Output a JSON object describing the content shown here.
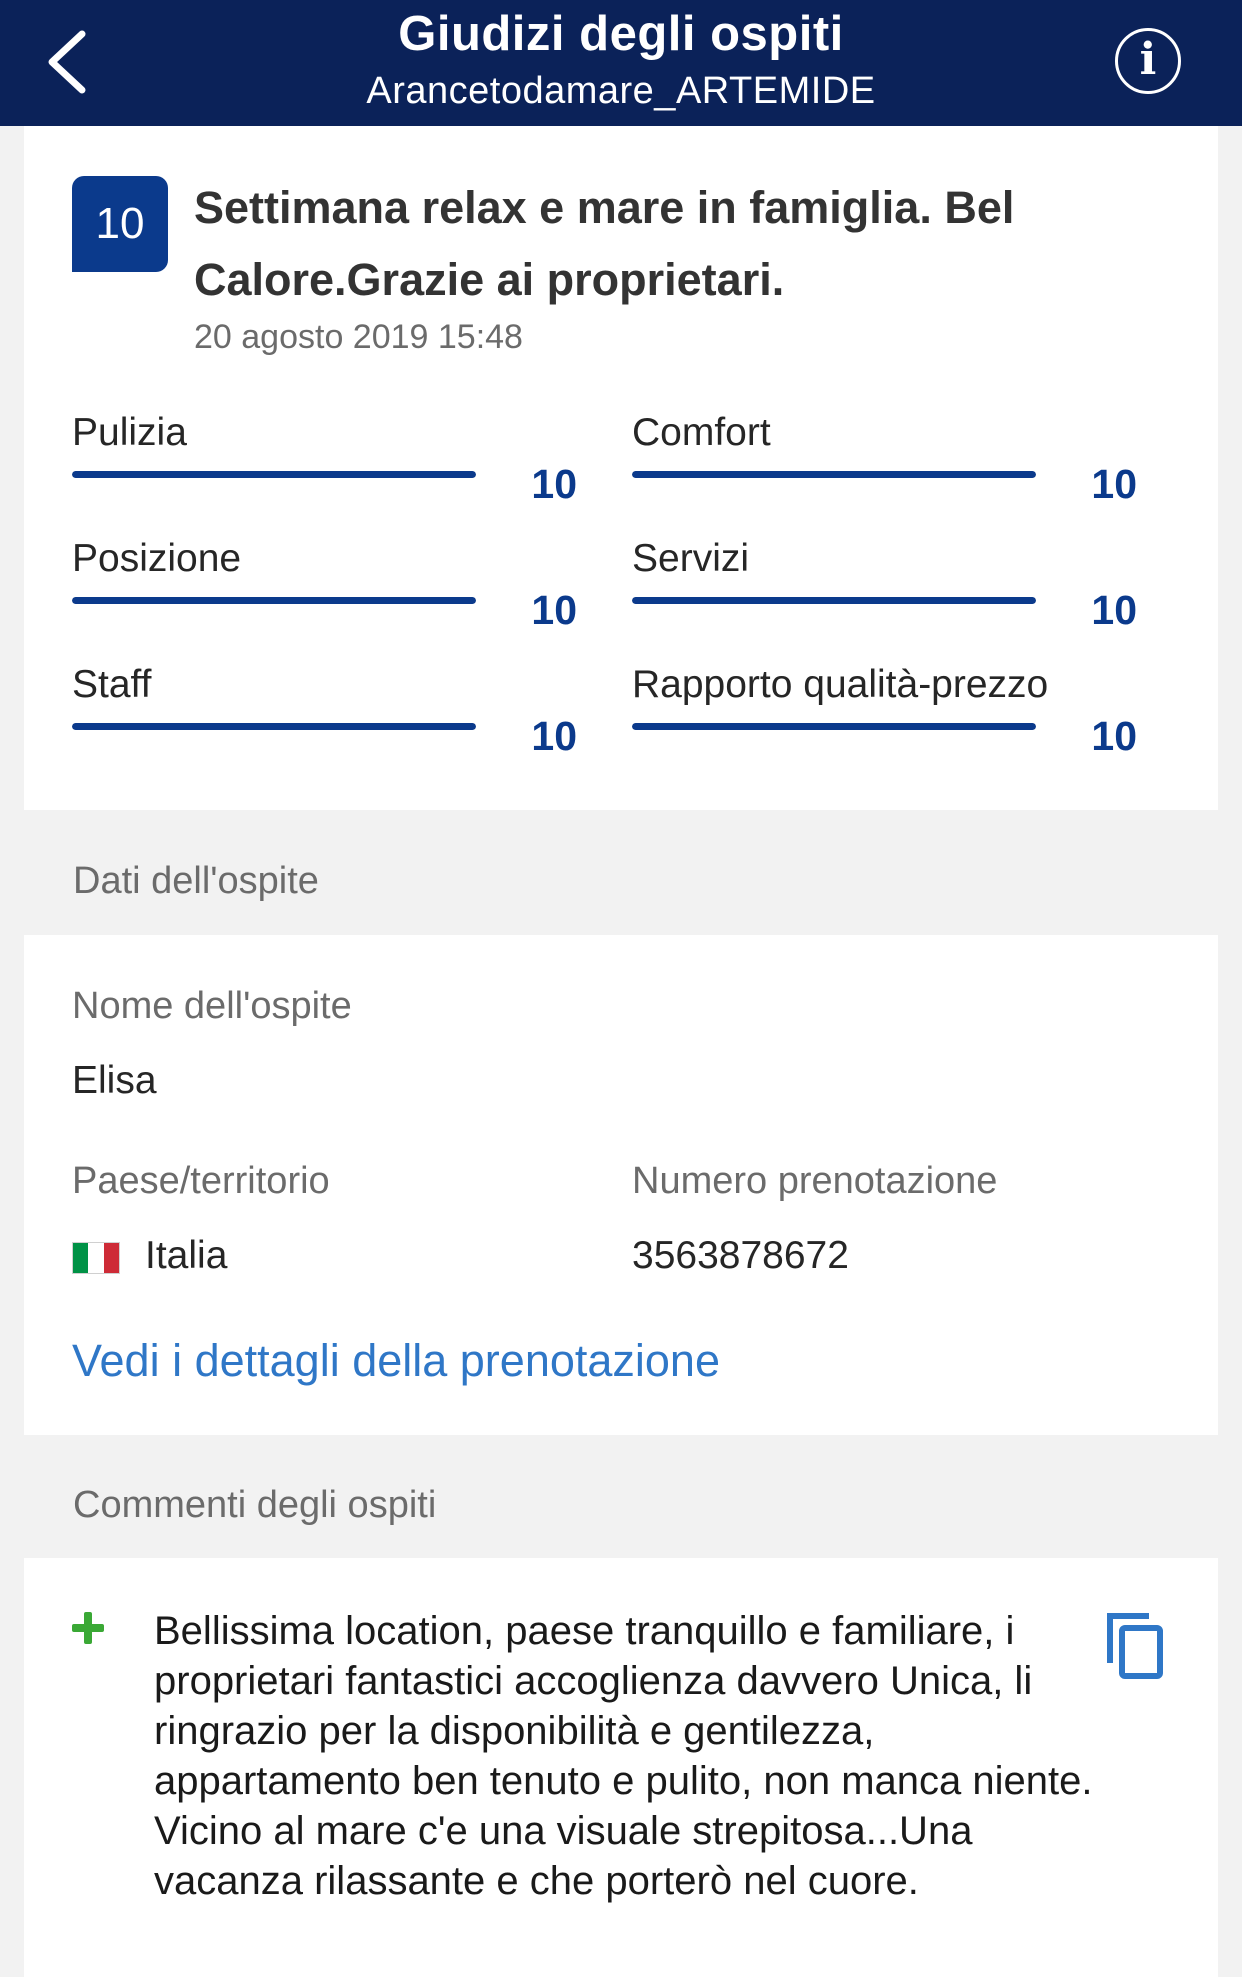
{
  "header": {
    "title": "Giudizi degli ospiti",
    "subtitle": "Arancetodamare_ARTEMIDE",
    "info_label": "i",
    "colors": {
      "background": "#0b2259",
      "text": "#ffffff"
    }
  },
  "review": {
    "score": "10",
    "title": "Settimana relax e mare in famiglia. Bel Calore.Grazie ai proprietari.",
    "date": "20 agosto 2019 15:48",
    "accent_color": "#0b3a8c",
    "ratings": [
      {
        "label": "Pulizia",
        "value": "10",
        "fraction": 1.0
      },
      {
        "label": "Comfort",
        "value": "10",
        "fraction": 1.0
      },
      {
        "label": "Posizione",
        "value": "10",
        "fraction": 1.0
      },
      {
        "label": "Servizi",
        "value": "10",
        "fraction": 1.0
      },
      {
        "label": "Staff",
        "value": "10",
        "fraction": 1.0
      },
      {
        "label": "Rapporto qualità-prezzo",
        "value": "10",
        "fraction": 1.0
      }
    ]
  },
  "guest": {
    "section_label": "Dati dell'ospite",
    "name_label": "Nome dell'ospite",
    "name_value": "Elisa",
    "country_label": "Paese/territorio",
    "country_value": "Italia",
    "country_flag_colors": [
      "#009246",
      "#ffffff",
      "#ce2b37"
    ],
    "booking_label": "Numero prenotazione",
    "booking_value": "3563878672",
    "details_link": "Vedi i dettagli della prenotazione"
  },
  "comments": {
    "section_label": "Commenti degli ospiti",
    "positive_icon": "plus-icon",
    "positive_color": "#3aa835",
    "positive_text": "Bellissima location, paese tranquillo e familiare, i proprietari fantastici accoglienza davvero Unica, li ringrazio per la disponibilità e gentilezza, appartamento ben tenuto e pulito, non manca niente. Vicino al mare c'e una visuale strepitosa...Una vacanza rilassante e che porterò nel cuore.",
    "copy_icon": "copy-icon"
  }
}
